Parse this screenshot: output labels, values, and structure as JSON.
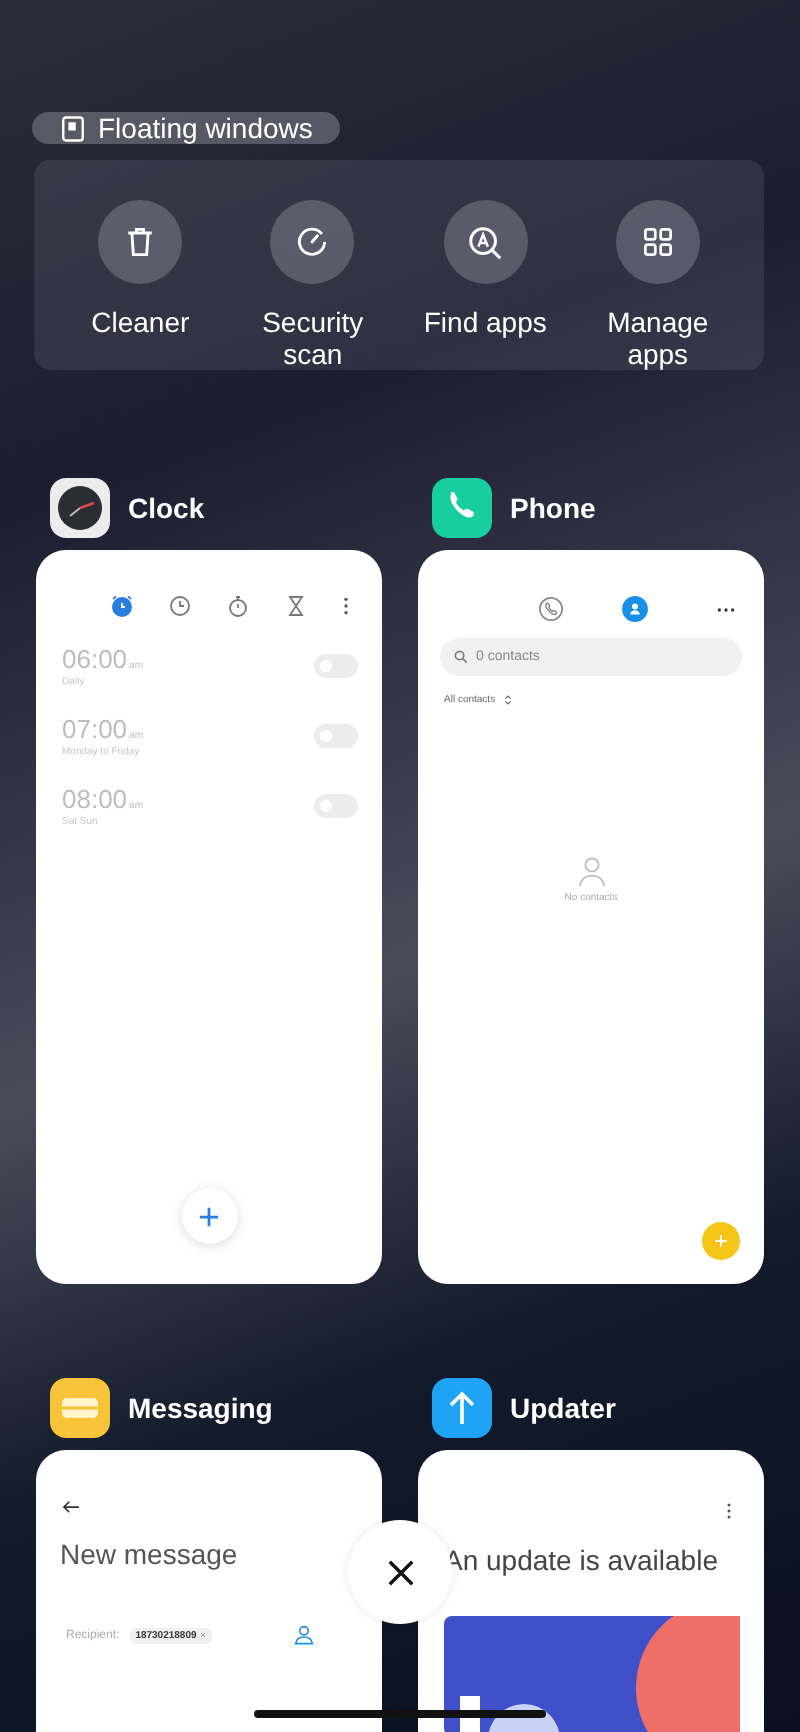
{
  "floating_button": {
    "label": "Floating windows"
  },
  "shortcuts": [
    {
      "kind": "cleaner",
      "label": "Cleaner"
    },
    {
      "kind": "security",
      "label": "Security scan"
    },
    {
      "kind": "find",
      "label": "Find apps"
    },
    {
      "kind": "manage",
      "label": "Manage apps"
    }
  ],
  "apps": [
    {
      "kind": "clock",
      "name": "Clock",
      "tabs": [
        {
          "kind": "alarm",
          "selected": true
        },
        {
          "kind": "world",
          "selected": false
        },
        {
          "kind": "stopwatch",
          "selected": false
        },
        {
          "kind": "timer",
          "selected": false
        }
      ],
      "alarms": [
        {
          "time": "06:00",
          "suffix": "am",
          "repeat": "Daily",
          "on": false
        },
        {
          "time": "07:00",
          "suffix": "am",
          "repeat": "Monday to Friday",
          "on": false
        },
        {
          "time": "08:00",
          "suffix": "am",
          "repeat": "Sat Sun",
          "on": false
        }
      ]
    },
    {
      "kind": "phone",
      "name": "Phone",
      "tabs": [
        {
          "kind": "dialer",
          "selected": false
        },
        {
          "kind": "contacts",
          "selected": true
        }
      ],
      "search": {
        "placeholder": "0 contacts"
      },
      "filter": "All contacts",
      "empty": "No contacts"
    },
    {
      "kind": "messaging",
      "name": "Messaging",
      "title": "New message",
      "recipient_label": "Recipient:",
      "recipient": "18730218809"
    },
    {
      "kind": "updater",
      "name": "Updater",
      "title": "An update is available"
    }
  ]
}
